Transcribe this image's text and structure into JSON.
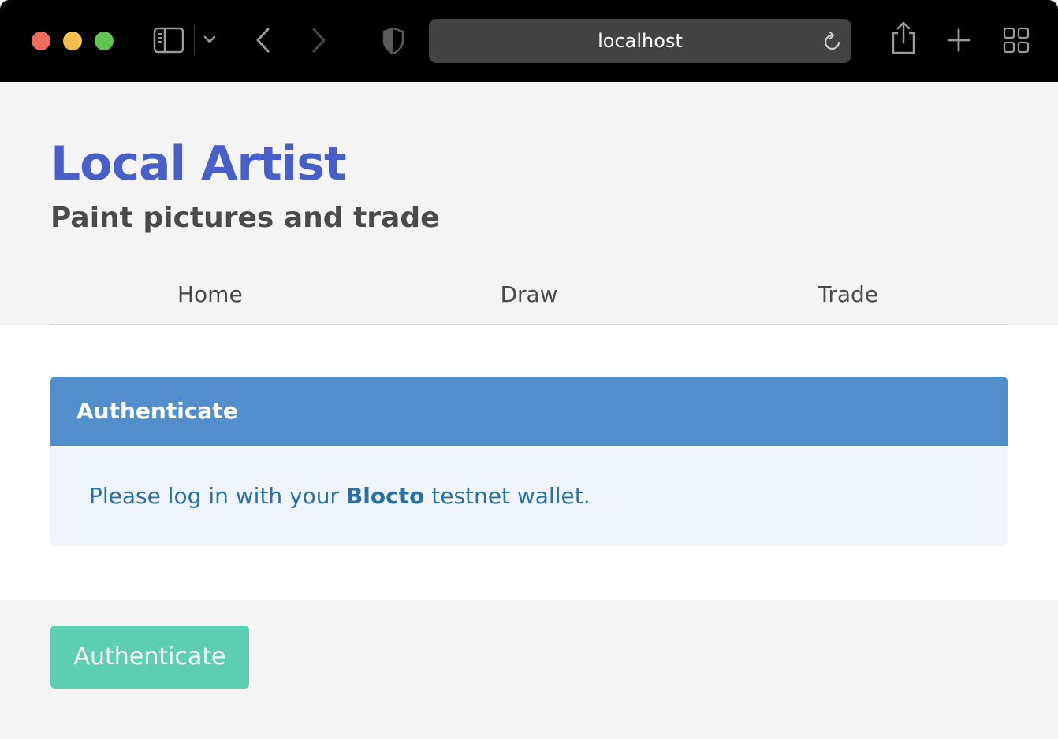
{
  "browser": {
    "url": "localhost",
    "traffic_lights": {
      "close": "#ed6a5e",
      "minimize": "#f5bf4f",
      "zoom": "#61c554"
    },
    "icons": [
      "sidebar-icon",
      "chevron-down-icon",
      "back-icon",
      "forward-icon",
      "shield-icon",
      "reload-icon",
      "share-icon",
      "new-tab-icon",
      "tab-overview-icon"
    ]
  },
  "hero": {
    "title": "Local Artist",
    "subtitle": "Paint pictures and trade"
  },
  "tabs": [
    {
      "label": "Home"
    },
    {
      "label": "Draw"
    },
    {
      "label": "Trade"
    }
  ],
  "message": {
    "header": "Authenticate",
    "body_prefix": "Please log in with your ",
    "body_bold": "Blocto",
    "body_suffix": " testnet wallet."
  },
  "footer": {
    "button_label": "Authenticate"
  },
  "colors": {
    "title": "#485fc7",
    "message_header_bg": "#518ecb",
    "message_body_bg": "#eff5fb",
    "message_text": "#296fa8",
    "button_bg": "#5dcfb0"
  }
}
